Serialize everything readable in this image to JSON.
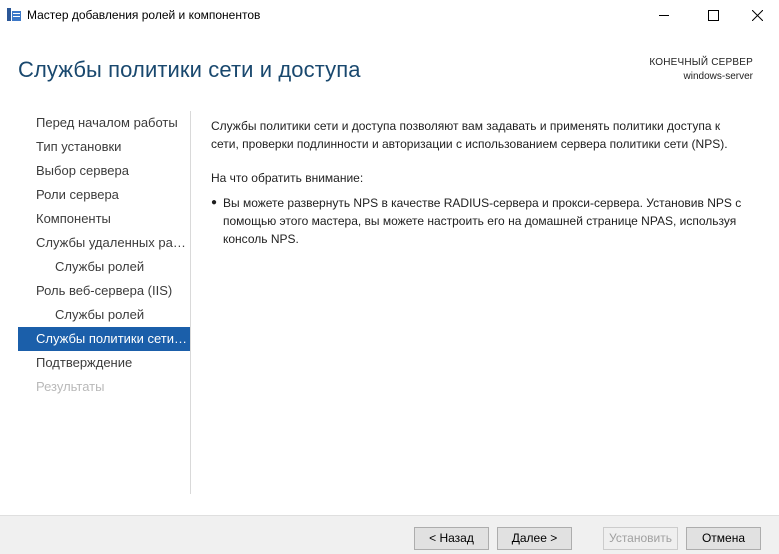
{
  "window": {
    "title": "Мастер добавления ролей и компонентов"
  },
  "header": {
    "page_title": "Службы политики сети и доступа",
    "dest_server_label": "КОНЕЧНЫЙ СЕРВЕР",
    "dest_server_name": "windows-server"
  },
  "nav": {
    "items": [
      {
        "label": "Перед началом работы"
      },
      {
        "label": "Тип установки"
      },
      {
        "label": "Выбор сервера"
      },
      {
        "label": "Роли сервера"
      },
      {
        "label": "Компоненты"
      },
      {
        "label": "Службы удаленных рабочих столов"
      },
      {
        "label": "Службы ролей"
      },
      {
        "label": "Роль веб-сервера (IIS)"
      },
      {
        "label": "Службы ролей"
      },
      {
        "label": "Службы политики сети и доступа"
      },
      {
        "label": "Подтверждение"
      },
      {
        "label": "Результаты"
      }
    ]
  },
  "content": {
    "intro": "Службы политики сети и доступа позволяют вам задавать и применять политики доступа к сети, проверки подлинности и авторизации с использованием сервера политики сети (NPS).",
    "note_heading": "На что обратить внимание:",
    "bullets": [
      "Вы можете развернуть NPS в качестве RADIUS-сервера и прокси-сервера. Установив NPS с помощью этого мастера, вы можете настроить его на домашней странице NPAS, используя консоль NPS."
    ]
  },
  "footer": {
    "back_label": "< Назад",
    "next_label": "Далее >",
    "install_label": "Установить",
    "cancel_label": "Отмена"
  }
}
